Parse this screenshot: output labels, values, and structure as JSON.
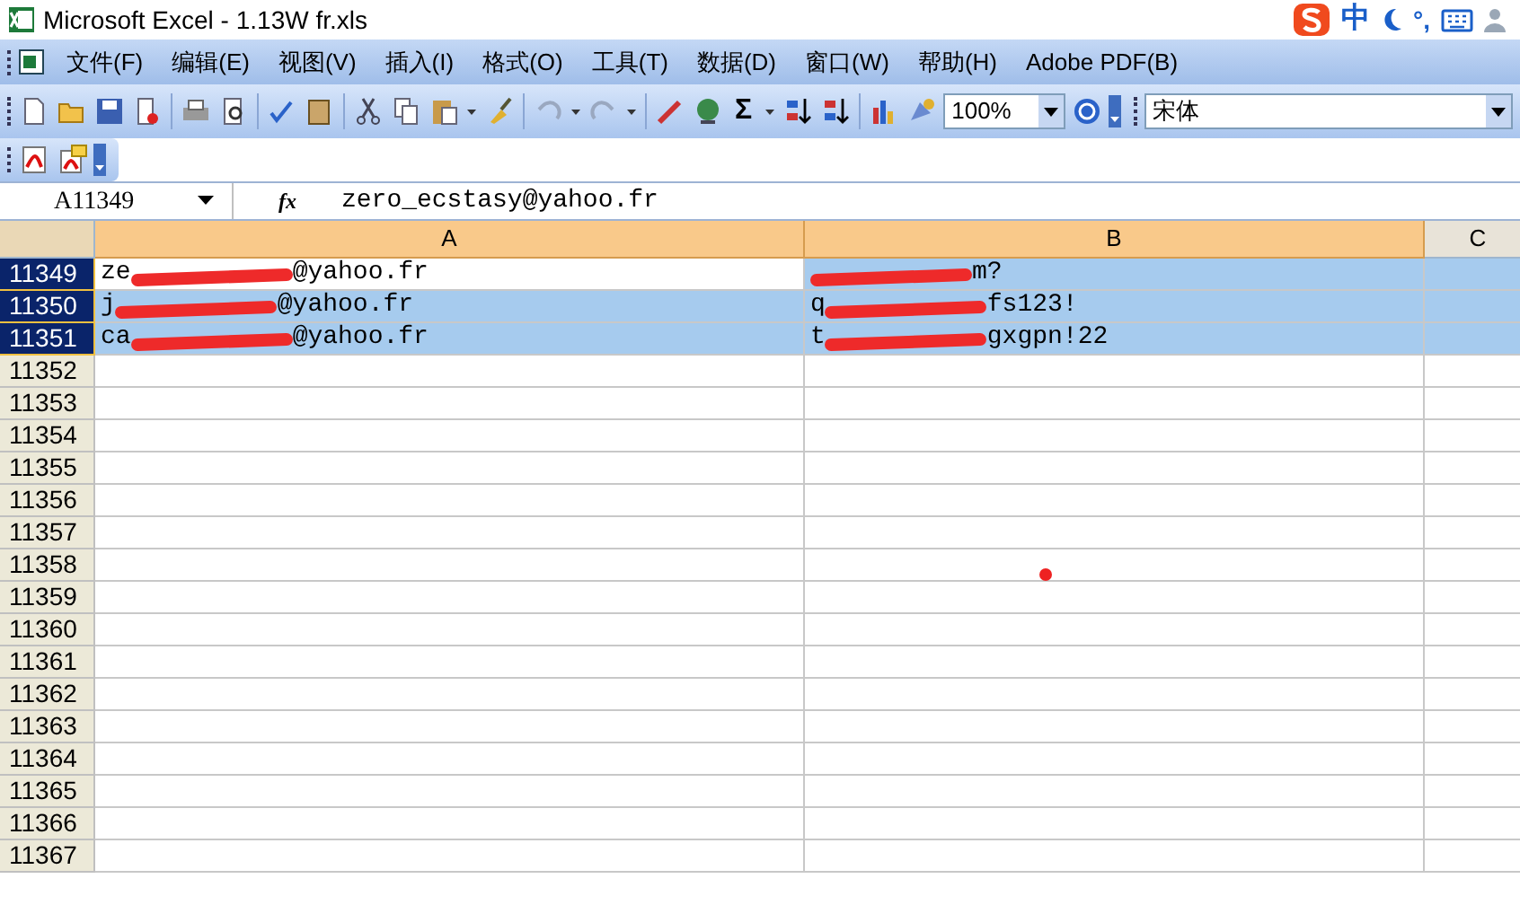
{
  "window": {
    "title": "Microsoft Excel - 1.13W fr.xls"
  },
  "ime": {
    "mode": "中",
    "punct": "°,"
  },
  "menu": [
    "文件(F)",
    "编辑(E)",
    "视图(V)",
    "插入(I)",
    "格式(O)",
    "工具(T)",
    "数据(D)",
    "窗口(W)",
    "帮助(H)",
    "Adobe PDF(B)"
  ],
  "toolbar": {
    "sum": "Σ",
    "zoom": "100%",
    "font": "宋体"
  },
  "formula_bar": {
    "name_box": "A11349",
    "fx": "fx",
    "value": "zero_ecstasy@yahoo.fr"
  },
  "columns": [
    {
      "label": "A"
    },
    {
      "label": "B"
    },
    {
      "label": "C"
    }
  ],
  "rows": [
    {
      "number": "11349",
      "selected": true,
      "cells": [
        {
          "before": "ze",
          "after": "@yahoo.fr",
          "redacted": true,
          "active": true
        },
        {
          "after": "m?",
          "redacted": true,
          "active": false
        }
      ]
    },
    {
      "number": "11350",
      "selected": true,
      "cells": [
        {
          "before": "j",
          "after": "@yahoo.fr",
          "redacted": true,
          "active": false
        },
        {
          "before": "q",
          "after": "fs123!",
          "redacted": true,
          "active": false
        }
      ]
    },
    {
      "number": "11351",
      "selected": true,
      "cells": [
        {
          "before": "ca",
          "after": "@yahoo.fr",
          "redacted": true,
          "active": false
        },
        {
          "before": "t",
          "after": "gxgpn!22",
          "redacted": true,
          "active": false
        }
      ]
    },
    {
      "number": "11352",
      "selected": false,
      "cells": []
    },
    {
      "number": "11353",
      "selected": false,
      "cells": []
    },
    {
      "number": "11354",
      "selected": false,
      "cells": []
    },
    {
      "number": "11355",
      "selected": false,
      "cells": []
    },
    {
      "number": "11356",
      "selected": false,
      "cells": []
    },
    {
      "number": "11357",
      "selected": false,
      "cells": []
    },
    {
      "number": "11358",
      "selected": false,
      "cells": []
    },
    {
      "number": "11359",
      "selected": false,
      "cells": []
    },
    {
      "number": "11360",
      "selected": false,
      "cells": []
    },
    {
      "number": "11361",
      "selected": false,
      "cells": []
    },
    {
      "number": "11362",
      "selected": false,
      "cells": []
    },
    {
      "number": "11363",
      "selected": false,
      "cells": []
    },
    {
      "number": "11364",
      "selected": false,
      "cells": []
    },
    {
      "number": "11365",
      "selected": false,
      "cells": []
    },
    {
      "number": "11366",
      "selected": false,
      "cells": []
    },
    {
      "number": "11367",
      "selected": false,
      "cells": []
    }
  ]
}
